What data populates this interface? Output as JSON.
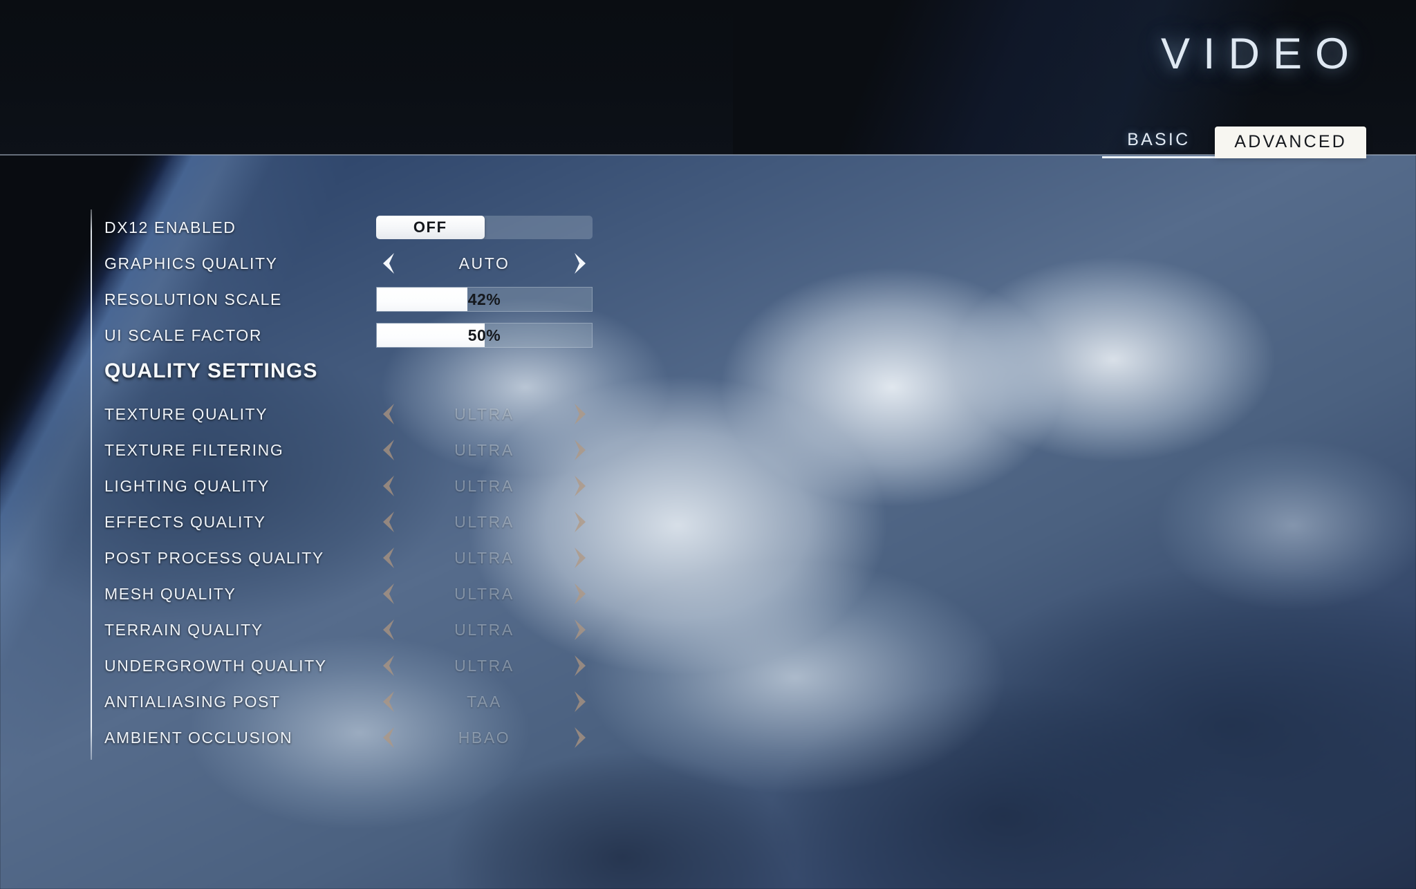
{
  "header": {
    "title": "VIDEO",
    "tabs": [
      {
        "label": "BASIC",
        "active": false
      },
      {
        "label": "ADVANCED",
        "active": true
      }
    ]
  },
  "colors": {
    "accent_white": "#f7f6f1",
    "label_text": "#f2f6fb",
    "arrow_active": "#f5f8fc",
    "arrow_disabled": "#b2977f",
    "slider_fill": "#ffffff",
    "rail": "#f0f6fc",
    "header_bg": "#0b0f15"
  },
  "settings": [
    {
      "label": "DX12 ENABLED",
      "control": "toggle",
      "value": "OFF",
      "knob_side": "left",
      "enabled": true
    },
    {
      "label": "GRAPHICS QUALITY",
      "control": "spinner",
      "value": "AUTO",
      "left_arrow": "chevron-left-icon",
      "right_arrow": "chevron-right-icon",
      "enabled": true
    },
    {
      "label": "RESOLUTION SCALE",
      "control": "slider",
      "value": "42%",
      "percent": 42,
      "enabled": true
    },
    {
      "label": "UI SCALE FACTOR",
      "control": "slider",
      "value": "50%",
      "percent": 50,
      "enabled": true
    }
  ],
  "quality_section": {
    "heading": "QUALITY SETTINGS",
    "items": [
      {
        "label": "TEXTURE QUALITY",
        "control": "spinner",
        "value": "ULTRA",
        "enabled": false
      },
      {
        "label": "TEXTURE FILTERING",
        "control": "spinner",
        "value": "ULTRA",
        "enabled": false
      },
      {
        "label": "LIGHTING QUALITY",
        "control": "spinner",
        "value": "ULTRA",
        "enabled": false
      },
      {
        "label": "EFFECTS QUALITY",
        "control": "spinner",
        "value": "ULTRA",
        "enabled": false
      },
      {
        "label": "POST PROCESS QUALITY",
        "control": "spinner",
        "value": "ULTRA",
        "enabled": false
      },
      {
        "label": "MESH QUALITY",
        "control": "spinner",
        "value": "ULTRA",
        "enabled": false
      },
      {
        "label": "TERRAIN QUALITY",
        "control": "spinner",
        "value": "ULTRA",
        "enabled": false
      },
      {
        "label": "UNDERGROWTH QUALITY",
        "control": "spinner",
        "value": "ULTRA",
        "enabled": false
      },
      {
        "label": "ANTIALIASING POST",
        "control": "spinner",
        "value": "TAA",
        "enabled": false
      },
      {
        "label": "AMBIENT OCCLUSION",
        "control": "spinner",
        "value": "HBAO",
        "enabled": false
      }
    ]
  },
  "background": {
    "scene": "earth-from-space-blurred"
  }
}
